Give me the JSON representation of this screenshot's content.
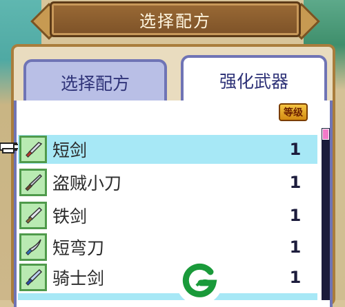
{
  "title": "选择配方",
  "tabs": [
    {
      "label": "选择配方",
      "active": false
    },
    {
      "label": "强化武器",
      "active": true
    }
  ],
  "level_header": "等级",
  "items": [
    {
      "name": "短剑",
      "level": "1",
      "icon": "short-sword-icon",
      "selected": true
    },
    {
      "name": "盗贼小刀",
      "level": "1",
      "icon": "thief-dagger-icon",
      "selected": false
    },
    {
      "name": "铁剑",
      "level": "1",
      "icon": "iron-sword-icon",
      "selected": false
    },
    {
      "name": "短弯刀",
      "level": "1",
      "icon": "short-scimitar-icon",
      "selected": false
    },
    {
      "name": "骑士剑",
      "level": "1",
      "icon": "knight-sword-icon",
      "selected": false
    }
  ],
  "colors": {
    "selected_row": "#a7e8f6",
    "tab_border": "#6f74b5",
    "title_plate": "#8a5c2e",
    "logo_green": "#1a9a3a"
  }
}
